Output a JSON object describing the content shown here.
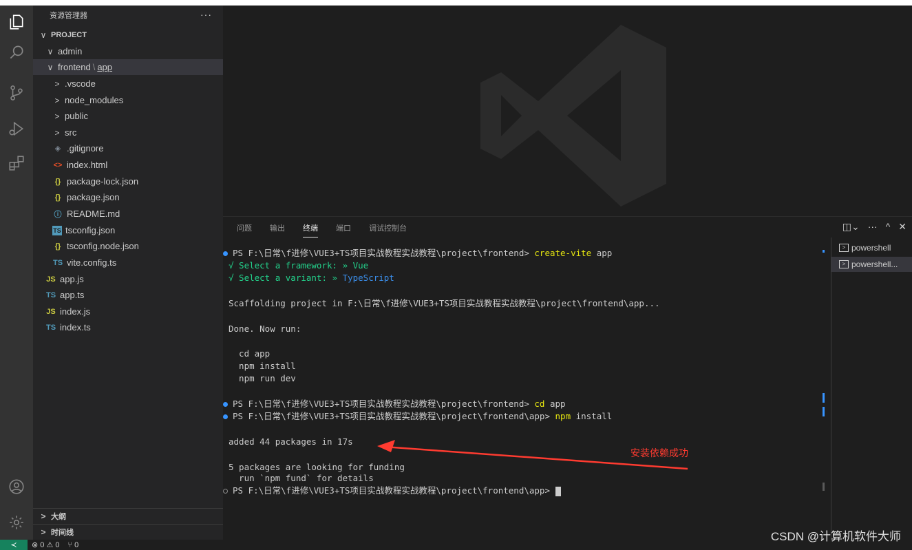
{
  "activity_bar": {
    "items": [
      "explorer-icon",
      "search-icon",
      "source-control-icon",
      "run-debug-icon",
      "extensions-icon"
    ],
    "bottom_items": [
      "account-icon",
      "settings-gear-icon"
    ]
  },
  "sidebar": {
    "title": "资源管理器",
    "more_label": "···",
    "project_label": "PROJECT",
    "tree": {
      "admin": "admin",
      "frontend": "frontend",
      "app": "app",
      "vscode": ".vscode",
      "node_modules": "node_modules",
      "public": "public",
      "src": "src",
      "gitignore": ".gitignore",
      "index_html": "index.html",
      "package_lock": "package-lock.json",
      "package_json": "package.json",
      "readme": "README.md",
      "tsconfig": "tsconfig.json",
      "tsconfig_node": "tsconfig.node.json",
      "vite_config": "vite.config.ts",
      "app_js": "app.js",
      "app_ts": "app.ts",
      "index_js": "index.js",
      "index_ts": "index.ts"
    },
    "icons": {
      "js": "JS",
      "ts": "TS",
      "json": "{}",
      "html": "<>",
      "info": "ⓘ",
      "gitignore": "◈"
    },
    "bottom": {
      "outline": "大纲",
      "timeline": "时间线"
    }
  },
  "panel": {
    "tabs": [
      "问题",
      "输出",
      "终端",
      "端口",
      "调试控制台"
    ],
    "active_tab": "终端",
    "actions": [
      "split-icon",
      "more-icon",
      "chevron-up-icon",
      "close-icon"
    ],
    "terminal": {
      "prompt1": "PS F:\\日常\\f进修\\VUE3+TS项目实战教程实战教程\\project\\frontend> ",
      "cmd1": "create-vite",
      "cmd1_arg": " app",
      "check1_label": "√ Select a framework: » ",
      "check1_value": "Vue",
      "check2_label": "√ Select a variant: » ",
      "check2_value": "TypeScript",
      "scaffold": "Scaffolding project in F:\\日常\\f进修\\VUE3+TS项目实战教程实战教程\\project\\frontend\\app...",
      "done": "Done. Now run:",
      "run1": "  cd app",
      "run2": "  npm install",
      "run3": "  npm run dev",
      "prompt2": "PS F:\\日常\\f进修\\VUE3+TS项目实战教程实战教程\\project\\frontend> ",
      "cmd2": "cd",
      "cmd2_arg": " app",
      "prompt3": "PS F:\\日常\\f进修\\VUE3+TS项目实战教程实战教程\\project\\frontend\\app> ",
      "cmd3": "npm",
      "cmd3_arg": " install",
      "added": "added 44 packages in 17s",
      "funding1": "5 packages are looking for funding",
      "funding2": "  run `npm fund` for details",
      "prompt4": "PS F:\\日常\\f进修\\VUE3+TS项目实战教程实战教程\\project\\frontend\\app> "
    },
    "terminal_list": [
      "powershell",
      "powershell..."
    ],
    "annotation": "安装依赖成功"
  },
  "status_bar": {
    "errors": "⊗ 0 ⚠ 0",
    "ports": "⑂ 0"
  },
  "watermark_text": "CSDN @计算机软件大师",
  "colors": {
    "activity_bar": "#333333",
    "sidebar": "#252526",
    "editor": "#1e1e1e",
    "accent_blue": "#3794ff",
    "annotation_red": "#ff3b30"
  }
}
